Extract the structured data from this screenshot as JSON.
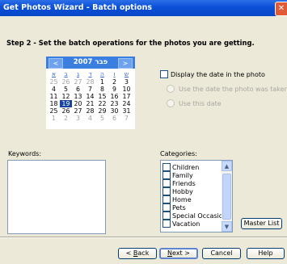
{
  "window": {
    "title": "Get Photos Wizard - Batch options"
  },
  "step_text": "Step 2 - Set the batch operations for the photos you are getting.",
  "calendar": {
    "title": "2007 פבר",
    "prev": "<",
    "next": ">",
    "weekdays": [
      "א",
      "ב",
      "ג",
      "ד",
      "ה",
      "ו",
      "ש"
    ],
    "weeks": [
      [
        {
          "d": "25",
          "o": true
        },
        {
          "d": "26",
          "o": true
        },
        {
          "d": "27",
          "o": true
        },
        {
          "d": "28",
          "o": true
        },
        {
          "d": "1"
        },
        {
          "d": "2"
        },
        {
          "d": "3"
        }
      ],
      [
        {
          "d": "4"
        },
        {
          "d": "5"
        },
        {
          "d": "6"
        },
        {
          "d": "7"
        },
        {
          "d": "8"
        },
        {
          "d": "9"
        },
        {
          "d": "10"
        }
      ],
      [
        {
          "d": "11"
        },
        {
          "d": "12"
        },
        {
          "d": "13"
        },
        {
          "d": "14"
        },
        {
          "d": "15"
        },
        {
          "d": "16"
        },
        {
          "d": "17"
        }
      ],
      [
        {
          "d": "18"
        },
        {
          "d": "19",
          "s": true
        },
        {
          "d": "20"
        },
        {
          "d": "21"
        },
        {
          "d": "22"
        },
        {
          "d": "23"
        },
        {
          "d": "24"
        }
      ],
      [
        {
          "d": "25"
        },
        {
          "d": "26"
        },
        {
          "d": "27"
        },
        {
          "d": "28"
        },
        {
          "d": "29"
        },
        {
          "d": "30"
        },
        {
          "d": "31"
        }
      ],
      [
        {
          "d": "1",
          "o": true
        },
        {
          "d": "2",
          "o": true
        },
        {
          "d": "3",
          "o": true
        },
        {
          "d": "4",
          "o": true
        },
        {
          "d": "5",
          "o": true
        },
        {
          "d": "6",
          "o": true
        },
        {
          "d": "7",
          "o": true
        }
      ]
    ]
  },
  "options": {
    "display_date": "Display the date in the photo",
    "use_taken_date": "Use the date the photo was taken",
    "use_this_date": "Use this date"
  },
  "keywords": {
    "label": "Keywords:"
  },
  "categories": {
    "label": "Categories:",
    "items": [
      "Children",
      "Family",
      "Friends",
      "Hobby",
      "Home",
      "Pets",
      "Special Occasions",
      "Vacation"
    ]
  },
  "buttons": {
    "master_list": "Master List",
    "back_pre": "< ",
    "back_key": "B",
    "back_post": "ack",
    "next_key": "N",
    "next_post": "ext >",
    "cancel": "Cancel",
    "help": "Help"
  },
  "colors": {
    "title_bar": "#0a4fd6",
    "calendar_header": "#3a7ee0",
    "selected_day": "#16449e",
    "window_bg": "#ece9d8"
  }
}
